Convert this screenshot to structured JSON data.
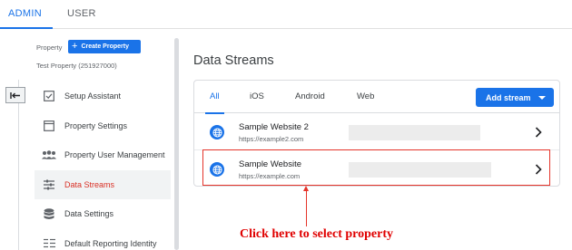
{
  "top_tabs": {
    "admin": "ADMIN",
    "user": "USER"
  },
  "sidebar": {
    "property_label": "Property",
    "create_property_label": "Create Property",
    "property_name": "Test Property (251927000)",
    "items": [
      {
        "label": "Setup Assistant",
        "icon": "checkbox-icon"
      },
      {
        "label": "Property Settings",
        "icon": "window-icon"
      },
      {
        "label": "Property User Management",
        "icon": "people-icon"
      },
      {
        "label": "Data Streams",
        "icon": "streams-icon",
        "active": true
      },
      {
        "label": "Data Settings",
        "icon": "database-icon"
      },
      {
        "label": "Default Reporting Identity",
        "icon": "identity-icon"
      }
    ]
  },
  "main": {
    "title": "Data Streams",
    "tabs": [
      "All",
      "iOS",
      "Android",
      "Web"
    ],
    "active_tab": "All",
    "add_stream_label": "Add stream",
    "streams": [
      {
        "name": "Sample Website 2",
        "url": "https://example2.com"
      },
      {
        "name": "Sample Website",
        "url": "https://example.com"
      }
    ]
  },
  "annotation": {
    "text": "Click here to select property"
  },
  "colors": {
    "accent": "#1a73e8",
    "active_text": "#d93025",
    "annotation": "#e00000"
  }
}
